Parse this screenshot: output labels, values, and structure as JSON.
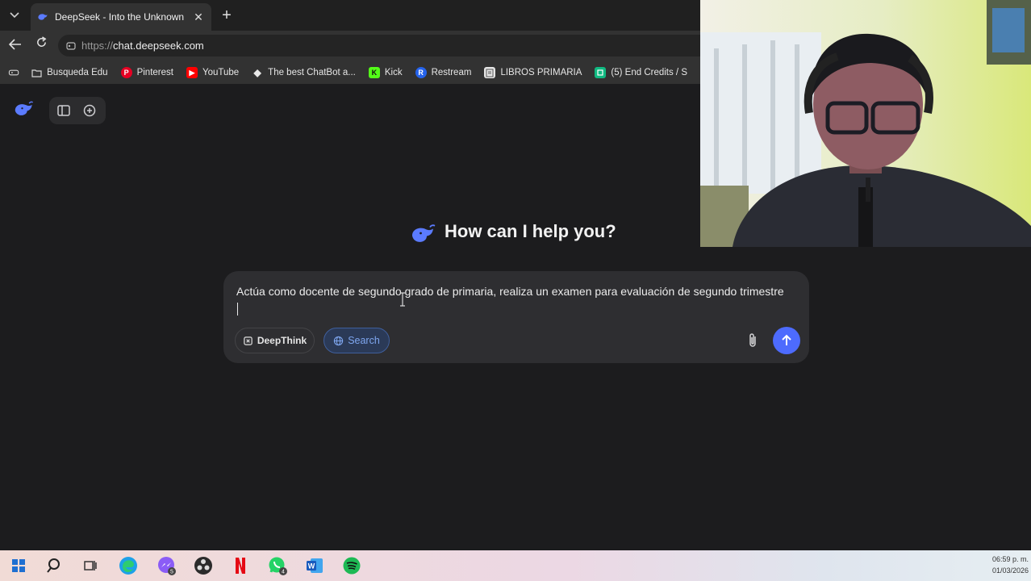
{
  "browser": {
    "tab": {
      "title": "DeepSeek - Into the Unknown",
      "close": "✕",
      "favicon": "deepseek-whale-icon"
    },
    "new_tab": "+",
    "url_prefix": "https://",
    "url_host": "chat.deepseek.com",
    "bookmarks": [
      {
        "label": "Busqueda Edu",
        "icon": "folder-icon"
      },
      {
        "label": "Pinterest",
        "icon": "pinterest-icon",
        "color": "#e60023"
      },
      {
        "label": "YouTube",
        "icon": "youtube-icon",
        "color": "#ff0000"
      },
      {
        "label": "The best ChatBot a...",
        "icon": "diamond-icon"
      },
      {
        "label": "Kick",
        "icon": "kick-icon",
        "color": "#53fc18"
      },
      {
        "label": "Restream",
        "icon": "restream-icon",
        "color": "#2563eb"
      },
      {
        "label": "LIBROS PRIMARIA",
        "icon": "book-icon"
      },
      {
        "label": "(5) End Credits / S",
        "icon": "app-icon",
        "color": "#10b981"
      }
    ]
  },
  "app": {
    "greeting": "How can I help you?",
    "input_text": "Actúa como docente de segundo grado de primaria, realiza un examen para evaluación de segundo trimestre",
    "deepthink_label": "DeepThink",
    "search_label": "Search",
    "accent": "#4d6bfe"
  },
  "taskbar": {
    "apps": [
      "windows-start-icon",
      "search-icon",
      "task-view-icon",
      "edge-icon",
      "messenger-icon",
      "obs-icon",
      "netflix-icon",
      "whatsapp-icon",
      "word-icon",
      "spotify-icon"
    ],
    "badges": {
      "messenger": "5",
      "whatsapp": "4"
    },
    "time": "06:59 p. m.",
    "date": "01/03/2026"
  }
}
